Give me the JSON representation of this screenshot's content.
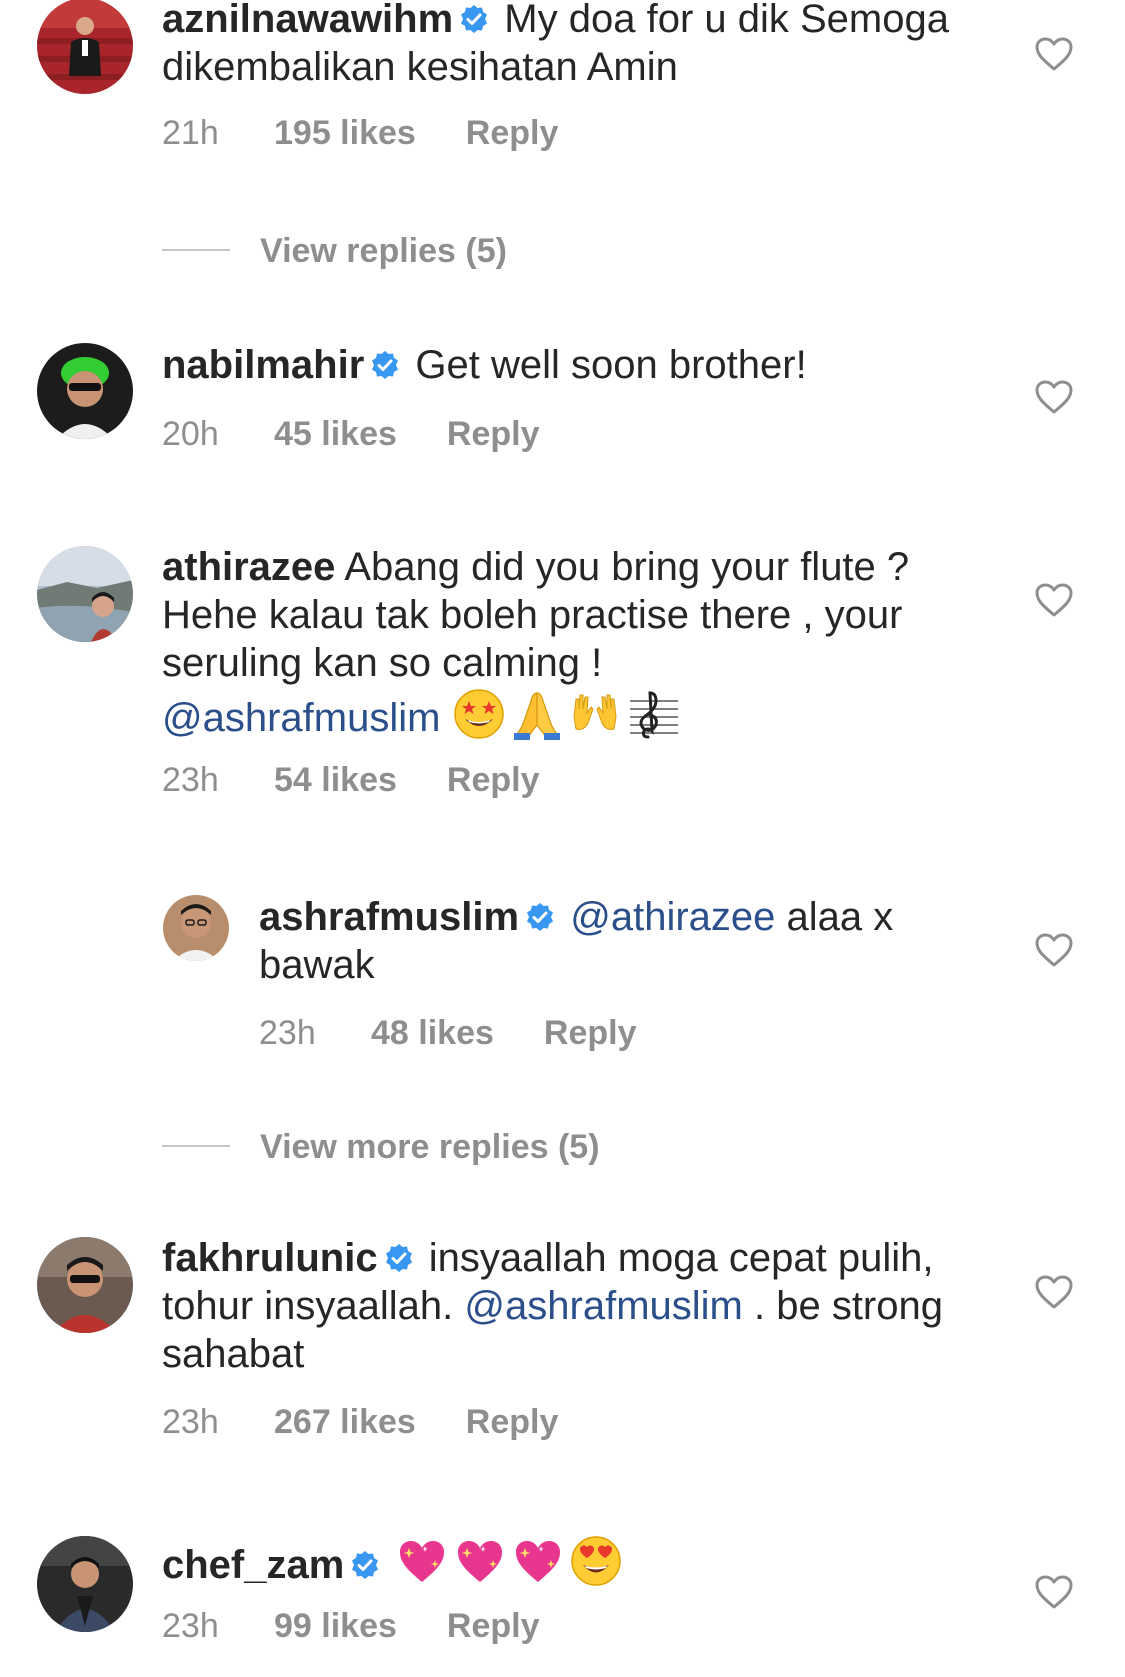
{
  "colors": {
    "text": "#262626",
    "meta": "#8e8e8e",
    "mention": "#2b4f8a",
    "verified": "#3897f0"
  },
  "comments": [
    {
      "username": "aznilnawawihm",
      "verified": true,
      "text": "My doa for u dik Semoga dikembalikan kesihatan Amin",
      "time": "21h",
      "likes": "195 likes",
      "reply": "Reply"
    },
    {
      "username": "nabilmahir",
      "verified": true,
      "text": "Get well soon brother!",
      "time": "20h",
      "likes": "45 likes",
      "reply": "Reply"
    },
    {
      "username": "athirazee",
      "verified": false,
      "text": "Abang did you bring your flute ? Hehe kalau tak boleh practise there , your seruling kan so calming !",
      "mention": "@ashrafmuslim",
      "emojis": [
        "star-struck-emoji",
        "folded-hands-emoji",
        "raising-hands-emoji",
        "music-staff-emoji"
      ],
      "time": "23h",
      "likes": "54 likes",
      "reply": "Reply"
    },
    {
      "username": "fakhrulunic",
      "verified": true,
      "text_before": "insyaallah moga cepat pulih, tohur insyaallah.",
      "mention": "@ashrafmuslim",
      "text_after": ". be strong sahabat",
      "time": "23h",
      "likes": "267 likes",
      "reply": "Reply"
    },
    {
      "username": "chef_zam",
      "verified": true,
      "emojis": [
        "sparkling-heart-emoji",
        "sparkling-heart-emoji",
        "sparkling-heart-emoji",
        "heart-eyes-emoji"
      ],
      "time": "23h",
      "likes": "99 likes",
      "reply": "Reply"
    }
  ],
  "replies": [
    {
      "username": "ashrafmuslim",
      "verified": true,
      "mention": "@athirazee",
      "text": "alaa x bawak",
      "time": "23h",
      "likes": "48 likes",
      "reply": "Reply"
    }
  ],
  "view_replies_label": "View replies (5)",
  "view_more_replies_label": "View more replies (5)"
}
